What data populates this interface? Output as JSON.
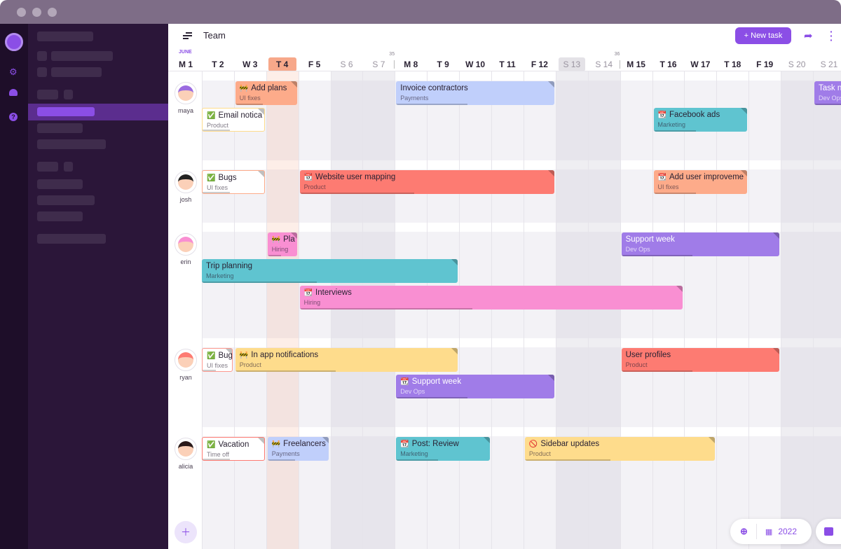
{
  "header": {
    "title": "Team",
    "new_task": "+ New task"
  },
  "month": "JUNE",
  "days": [
    {
      "label": "M 1"
    },
    {
      "label": "T 2"
    },
    {
      "label": "W 3"
    },
    {
      "label": "T 4",
      "today": true
    },
    {
      "label": "F 5"
    },
    {
      "label": "S 6",
      "weekend": true
    },
    {
      "label": "S 7",
      "weekend": true
    },
    {
      "label": "M 8",
      "week": "35"
    },
    {
      "label": "T 9"
    },
    {
      "label": "W 10"
    },
    {
      "label": "T 11"
    },
    {
      "label": "F 12"
    },
    {
      "label": "S 13",
      "weekend": true,
      "selected": true
    },
    {
      "label": "S 14",
      "weekend": true
    },
    {
      "label": "M 15",
      "week": "36"
    },
    {
      "label": "T 16"
    },
    {
      "label": "W 17"
    },
    {
      "label": "T 18"
    },
    {
      "label": "F 19"
    },
    {
      "label": "S 20",
      "weekend": true
    },
    {
      "label": "S 21",
      "weekend": true
    }
  ],
  "colors": {
    "orange": "#fdab8a",
    "blue": "#c0cffb",
    "purple": "#a07ce8",
    "teal": "#5fc4d0",
    "red": "#fd7b72",
    "pink": "#f98fd2",
    "yellow": "#fedc8c",
    "white": "#ffffff",
    "accent": "#8b4ee6"
  },
  "people": [
    {
      "name": "maya",
      "lanes": 3,
      "hair": "#9b6be0",
      "tasks": [
        {
          "title": "Add plans",
          "sub": "UI fixes",
          "icon": "🚧",
          "start": 3,
          "end": 4,
          "lane": 0,
          "color": "orange"
        },
        {
          "title": "Invoice contractors",
          "sub": "Payments",
          "icon": "",
          "start": 8,
          "end": 12,
          "lane": 0,
          "color": "blue"
        },
        {
          "title": "Task n",
          "sub": "Dev Ops",
          "icon": "",
          "start": 21,
          "end": 22,
          "lane": 0,
          "color": "purple"
        },
        {
          "title": "Email notica",
          "sub": "Product",
          "icon": "✅",
          "start": 1,
          "end": 3,
          "lane": 1,
          "color": "white",
          "border": "#fedc8c"
        },
        {
          "title": "Facebook ads",
          "sub": "Marketing",
          "icon": "📆",
          "start": 16,
          "end": 18,
          "lane": 1,
          "color": "teal"
        }
      ]
    },
    {
      "name": "josh",
      "lanes": 2,
      "hair": "#222",
      "tasks": [
        {
          "title": "Bugs",
          "sub": "UI fixes",
          "icon": "✅",
          "start": 1,
          "end": 3,
          "lane": 0,
          "color": "white",
          "border": "#fdab8a"
        },
        {
          "title": "Website user mapping",
          "sub": "Product",
          "icon": "📆",
          "start": 5,
          "end": 12,
          "lane": 0,
          "color": "red"
        },
        {
          "title": "Add user improveme",
          "sub": "UI fixes",
          "icon": "📆",
          "start": 16,
          "end": 18,
          "lane": 0,
          "color": "orange"
        }
      ]
    },
    {
      "name": "erin",
      "lanes": 4,
      "hair": "#f98fd2",
      "tasks": [
        {
          "title": "Pla",
          "sub": "Hiring",
          "icon": "🚧",
          "start": 4,
          "end": 4,
          "lane": 0,
          "color": "pink"
        },
        {
          "title": "Support week",
          "sub": "Dev Ops",
          "icon": "",
          "start": 15,
          "end": 19,
          "lane": 0,
          "color": "purple"
        },
        {
          "title": "Trip planning",
          "sub": "Marketing",
          "icon": "",
          "start": 1,
          "end": 9,
          "lane": 1,
          "color": "teal"
        },
        {
          "title": "Interviews",
          "sub": "Hiring",
          "icon": "📆",
          "start": 5,
          "end": 16,
          "lane": 2,
          "color": "pink"
        }
      ]
    },
    {
      "name": "ryan",
      "lanes": 3,
      "hair": "#fd7b72",
      "tasks": [
        {
          "title": "Bug",
          "sub": "UI fixes",
          "icon": "✅",
          "start": 1,
          "end": 2,
          "lane": 0,
          "color": "white",
          "border": "#fd9a90"
        },
        {
          "title": "In app notifications",
          "sub": "Product",
          "icon": "🚧",
          "start": 3,
          "end": 9,
          "lane": 0,
          "color": "yellow"
        },
        {
          "title": "User profiles",
          "sub": "Product",
          "icon": "",
          "start": 15,
          "end": 19,
          "lane": 0,
          "color": "red"
        },
        {
          "title": "Support week",
          "sub": "Dev Ops",
          "icon": "📆",
          "start": 8,
          "end": 12,
          "lane": 1,
          "color": "purple"
        }
      ]
    },
    {
      "name": "alicia",
      "lanes": 4,
      "hair": "#2a1a1a",
      "tasks": [
        {
          "title": "Vacation",
          "sub": "Time off",
          "icon": "✅",
          "start": 1,
          "end": 3,
          "lane": 0,
          "color": "white",
          "border": "#fd7b72"
        },
        {
          "title": "Freelancers",
          "sub": "Payments",
          "icon": "🚧",
          "start": 4,
          "end": 5,
          "lane": 0,
          "color": "blue"
        },
        {
          "title": "Post: Review",
          "sub": "Marketing",
          "icon": "📆",
          "start": 8,
          "end": 10,
          "lane": 0,
          "color": "teal"
        },
        {
          "title": "Sidebar updates",
          "sub": "Product",
          "icon": "🚫",
          "start": 12,
          "end": 17,
          "lane": 0,
          "color": "yellow"
        }
      ]
    }
  ],
  "footer": {
    "year": "2022"
  }
}
